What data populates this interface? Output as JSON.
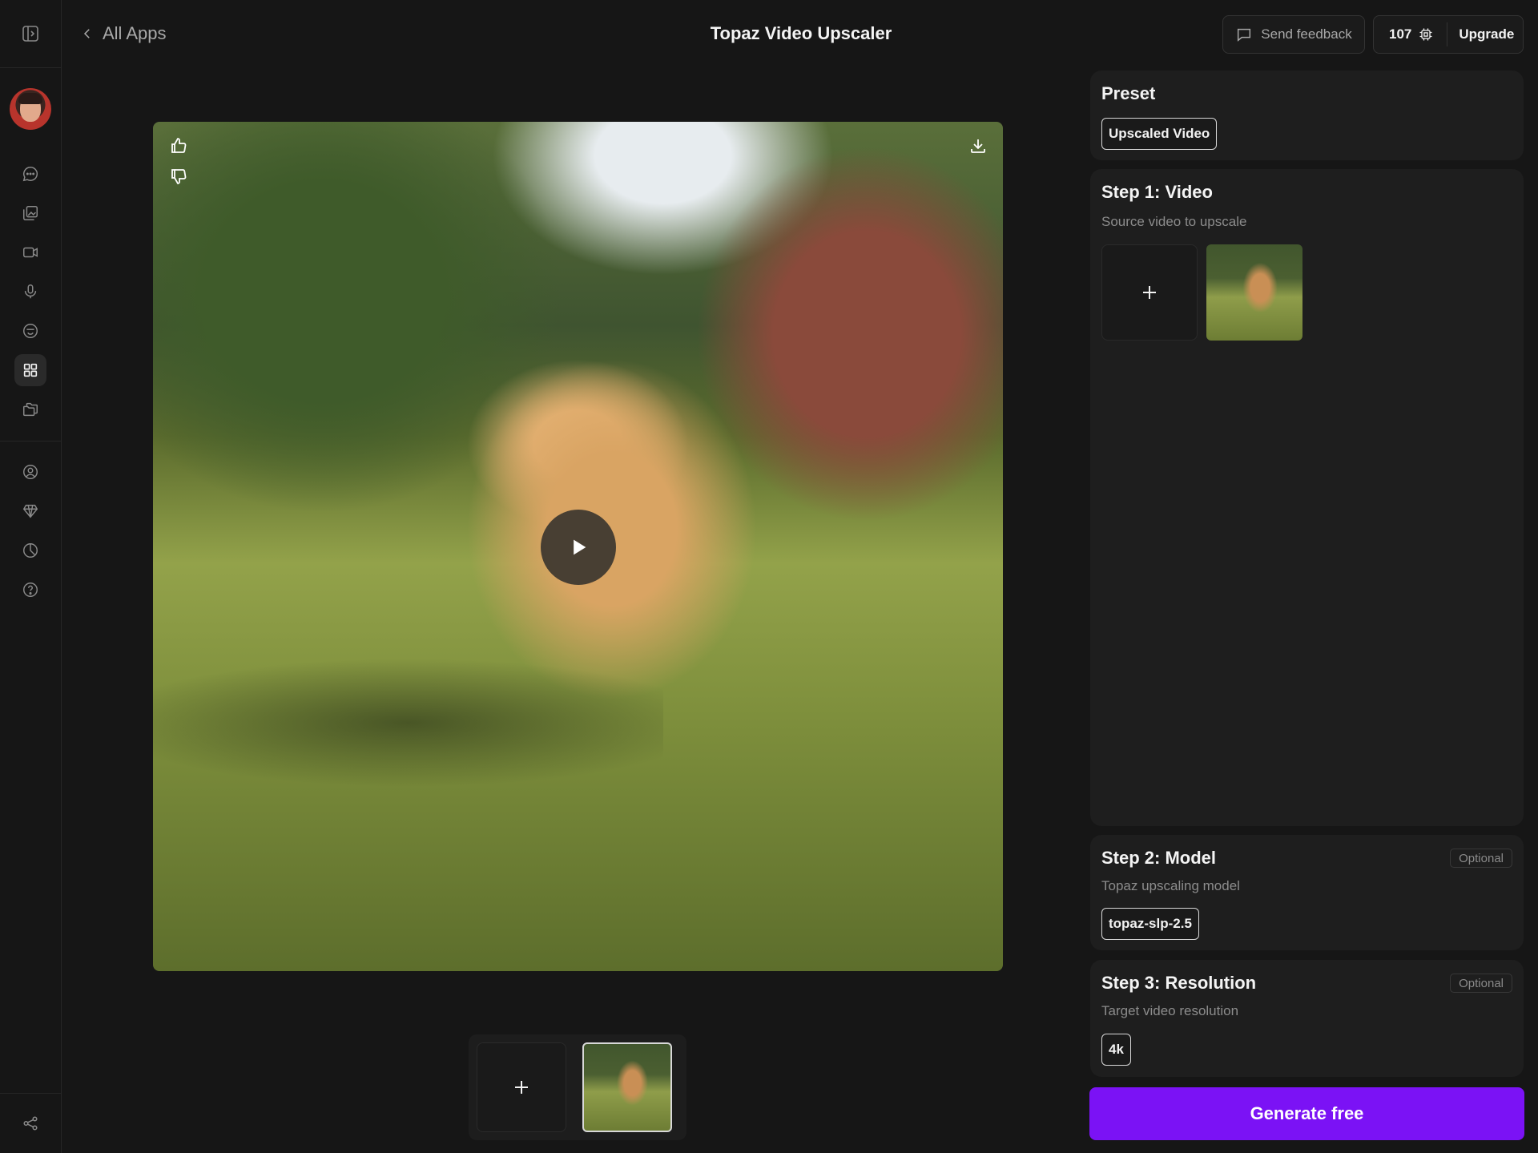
{
  "header": {
    "back_label": "All Apps",
    "title": "Topaz Video Upscaler",
    "feedback_label": "Send feedback",
    "credits": "107",
    "upgrade_label": "Upgrade"
  },
  "sidebar": {
    "items": [
      {
        "icon": "panel-toggle-icon"
      },
      {
        "icon": "avatar"
      },
      {
        "icon": "chat-icon"
      },
      {
        "icon": "images-icon"
      },
      {
        "icon": "video-icon"
      },
      {
        "icon": "microphone-icon"
      },
      {
        "icon": "smiley-icon"
      },
      {
        "icon": "apps-grid-icon",
        "active": true
      },
      {
        "icon": "folders-icon"
      },
      {
        "icon": "account-icon"
      },
      {
        "icon": "diamond-icon"
      },
      {
        "icon": "usage-pie-icon"
      },
      {
        "icon": "help-icon"
      },
      {
        "icon": "share-icon"
      }
    ]
  },
  "preview": {
    "actions": [
      "thumbs-up-icon",
      "thumbs-down-icon",
      "download-icon",
      "play-icon"
    ]
  },
  "panel": {
    "preset": {
      "title": "Preset",
      "chip": "Upscaled Video"
    },
    "step1": {
      "title": "Step 1: Video",
      "subtitle": "Source video to upscale"
    },
    "step2": {
      "title": "Step 2: Model",
      "subtitle": "Topaz upscaling model",
      "badge": "Optional",
      "chip": "topaz-slp-2.5"
    },
    "step3": {
      "title": "Step 3: Resolution",
      "subtitle": "Target video resolution",
      "badge": "Optional",
      "chip": "4k"
    },
    "generate_label": "Generate free"
  },
  "colors": {
    "background": "#161616",
    "card": "#1e1e1e",
    "accent": "#7b12f5"
  }
}
